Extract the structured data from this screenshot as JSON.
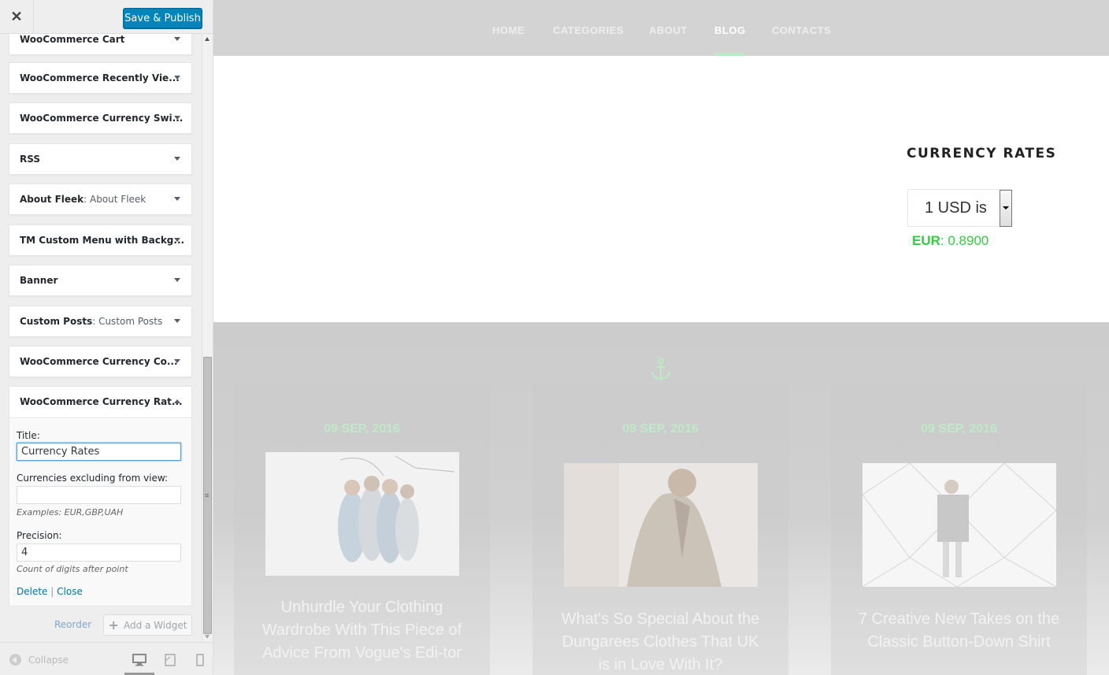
{
  "customizer": {
    "close_label": "✕",
    "publish_label": "Save & Publish",
    "widgets": [
      {
        "title": "WooCommerce Cart",
        "sub": ""
      },
      {
        "title": "WooCommerce Recently Vie...",
        "sub": ""
      },
      {
        "title": "WooCommerce Currency Swi...",
        "sub": ""
      },
      {
        "title": "RSS",
        "sub": ""
      },
      {
        "title": "About Fleek",
        "sub": ": About Fleek"
      },
      {
        "title": "TM Custom Menu with Backg...",
        "sub": ""
      },
      {
        "title": "Banner",
        "sub": ""
      },
      {
        "title": "Custom Posts",
        "sub": ": Custom Posts"
      },
      {
        "title": "WooCommerce Currency Co...",
        "sub": ""
      }
    ],
    "open_widget": {
      "title": "WooCommerce Currency Rat...",
      "title_label": "Title:",
      "title_value": "Currency Rates",
      "exclude_label": "Currencies excluding from view:",
      "exclude_value": "",
      "exclude_hint": "Examples: EUR,GBP,UAH",
      "precision_label": "Precision:",
      "precision_value": "4",
      "precision_hint": "Count of digits after point",
      "delete_label": "Delete",
      "separator": "|",
      "close_label": "Close"
    },
    "reorder_label": "Reorder",
    "add_widget_label": "Add a Widget",
    "collapse_label": "Collapse"
  },
  "preview": {
    "nav": [
      {
        "label": "HOME",
        "active": false
      },
      {
        "label": "CATEGORIES",
        "active": false
      },
      {
        "label": "ABOUT",
        "active": false
      },
      {
        "label": "BLOG",
        "active": true
      },
      {
        "label": "CONTACTS",
        "active": false
      }
    ],
    "currency_widget": {
      "title": "CURRENCY RATES",
      "select_value": "1 USD is",
      "rate_code": "EUR",
      "rate_value": ": 0.8900"
    },
    "posts": [
      {
        "date": "09 SEP, 2016",
        "title": "Unhurdle Your Clothing Wardrobe With This Piece of Advice From Vogue's Edi-tor"
      },
      {
        "date": "09 SEP, 2016",
        "title": "What's So Special About the Dungarees Clothes That UK is in Love With It?"
      },
      {
        "date": "09 SEP, 2016",
        "title": "7 Creative New Takes on the Classic Button-Down Shirt"
      }
    ]
  },
  "colors": {
    "publish_button": "#0085ba",
    "link": "#0073aa",
    "accent_green": "#33cc44",
    "nav_bg": "#d3d3d3"
  }
}
